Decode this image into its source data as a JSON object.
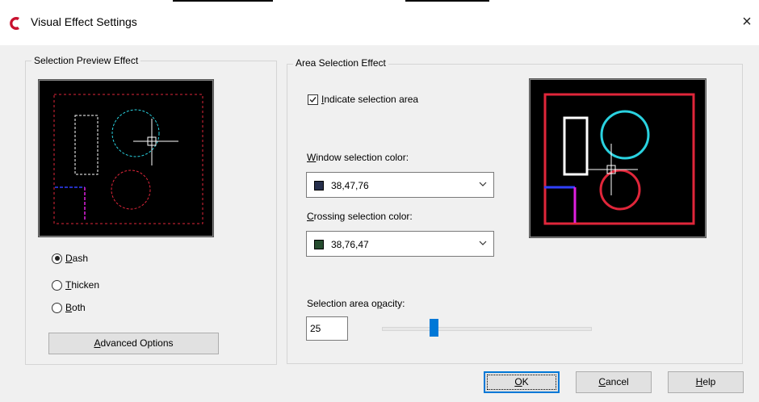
{
  "window": {
    "title": "Visual Effect Settings",
    "close_glyph": "×",
    "app_icon": "app-logo-icon"
  },
  "selection_preview": {
    "group_label": "Selection Preview Effect",
    "options": [
      {
        "key": "D",
        "rest": "ash",
        "selected": true
      },
      {
        "key": "T",
        "rest": "hicken",
        "selected": false
      },
      {
        "key": "B",
        "rest": "oth",
        "selected": false
      }
    ],
    "advanced_key": "A",
    "advanced_rest": "dvanced Options"
  },
  "area_selection": {
    "group_label": "Area Selection Effect",
    "indicate_key": "I",
    "indicate_rest": "ndicate selection area",
    "indicate_checked": true,
    "window_color_key": "W",
    "window_color_rest": "indow selection color:",
    "window_color_value": "38,47,76",
    "window_color_hex": "#262f4c",
    "crossing_color_key": "C",
    "crossing_color_rest": "rossing selection color:",
    "crossing_color_value": "38,76,47",
    "crossing_color_hex": "#264c2f",
    "opacity_label_pre": "Selection area o",
    "opacity_label_key": "p",
    "opacity_label_post": "acity:",
    "opacity_value": "25",
    "opacity_fraction": 0.25
  },
  "buttons": {
    "ok_key": "O",
    "ok_rest": "K",
    "cancel_key": "C",
    "cancel_rest": "ancel",
    "help_key": "H",
    "help_rest": "elp"
  }
}
